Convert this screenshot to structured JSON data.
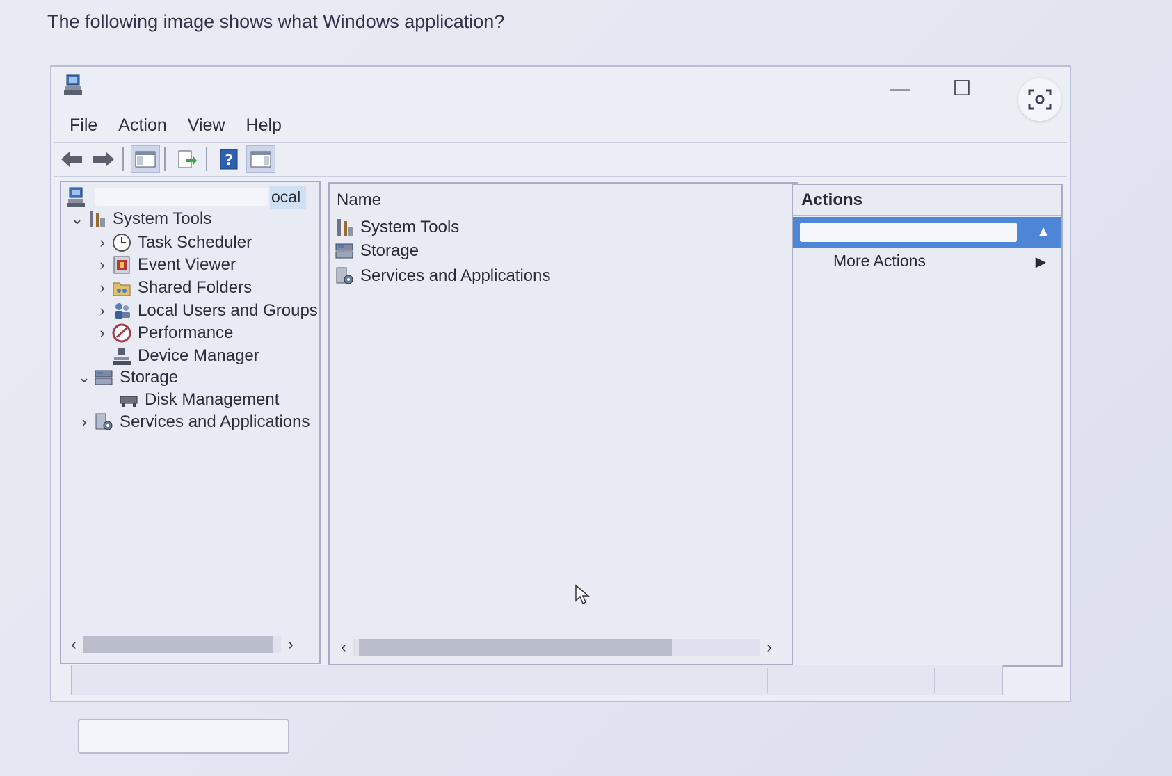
{
  "question": "The following image shows what Windows application?",
  "window": {
    "app_icon": "computer-management-icon",
    "controls": {
      "minimize": "—",
      "maximize": "☐"
    }
  },
  "menu": [
    "File",
    "Action",
    "View",
    "Help"
  ],
  "toolbar": {
    "buttons": [
      "back-arrow-icon",
      "forward-arrow-icon",
      "show-hide-console-tree-icon",
      "export-list-icon",
      "help-icon",
      "show-hide-action-pane-icon"
    ]
  },
  "tree": {
    "root_label": "ocal",
    "items": [
      {
        "label": "System Tools",
        "icon": "tools-icon",
        "expander": "expanded"
      },
      {
        "label": "Task Scheduler",
        "icon": "clock-icon",
        "expander": "collapsed"
      },
      {
        "label": "Event Viewer",
        "icon": "event-viewer-icon",
        "expander": "collapsed"
      },
      {
        "label": "Shared Folders",
        "icon": "shared-folder-icon",
        "expander": "collapsed"
      },
      {
        "label": "Local Users and Groups",
        "icon": "users-icon",
        "expander": "collapsed"
      },
      {
        "label": "Performance",
        "icon": "performance-icon",
        "expander": "collapsed"
      },
      {
        "label": "Device Manager",
        "icon": "device-manager-icon",
        "expander": "none"
      },
      {
        "label": "Storage",
        "icon": "storage-icon",
        "expander": "expanded"
      },
      {
        "label": "Disk Management",
        "icon": "disk-icon",
        "expander": "none"
      },
      {
        "label": "Services and Applications",
        "icon": "services-icon",
        "expander": "collapsed"
      }
    ]
  },
  "list": {
    "column_header": "Name",
    "rows": [
      {
        "label": "System Tools",
        "icon": "tools-icon"
      },
      {
        "label": "Storage",
        "icon": "storage-icon"
      },
      {
        "label": "Services and Applications",
        "icon": "services-icon"
      }
    ]
  },
  "actions": {
    "title": "Actions",
    "more_actions": "More Actions"
  }
}
